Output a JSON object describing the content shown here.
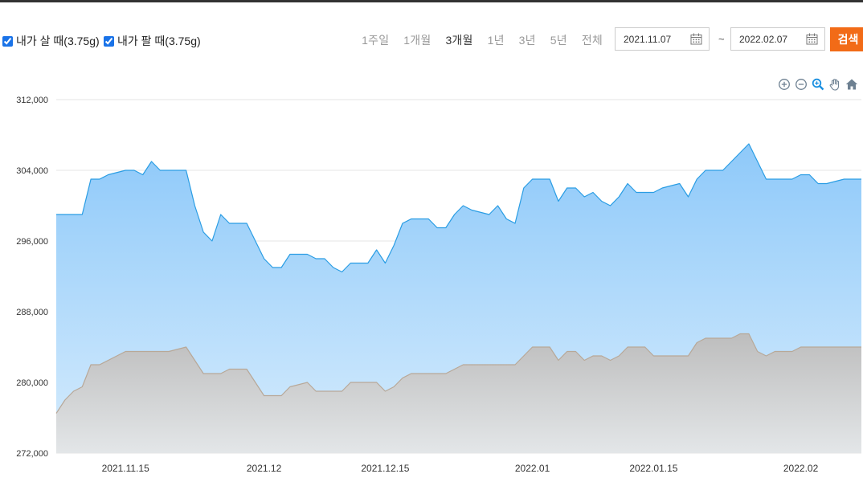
{
  "filters": {
    "buy_label": "내가 살 때(3.75g)",
    "sell_label": "내가 팔 때(3.75g)"
  },
  "periods": [
    {
      "label": "1주일",
      "active": false
    },
    {
      "label": "1개월",
      "active": false
    },
    {
      "label": "3개월",
      "active": true
    },
    {
      "label": "1년",
      "active": false
    },
    {
      "label": "3년",
      "active": false
    },
    {
      "label": "5년",
      "active": false
    },
    {
      "label": "전체",
      "active": false
    }
  ],
  "date_range": {
    "start": "2021.11.07",
    "separator": "~",
    "end": "2022.02.07"
  },
  "search_label": "검색",
  "icons": {
    "zoom_in": "zoom-in-icon",
    "zoom_out": "zoom-out-icon",
    "selection_zoom": "magnifier-icon",
    "pan": "hand-pan-icon",
    "reset": "home-icon",
    "calendar": "calendar-icon"
  },
  "colors": {
    "buy_line": "#2a9de4",
    "buy_fill_top": "#8ec9f9",
    "buy_fill_bottom": "#d6ecfd",
    "sell_line": "#b8a898",
    "sell_fill_top": "#bdbdbd",
    "sell_fill_bottom": "#e3e6e8",
    "search_button": "#f26b17"
  },
  "chart_data": {
    "type": "area",
    "ylim": [
      272000,
      312000
    ],
    "yticks": [
      "272,000",
      "280,000",
      "288,000",
      "296,000",
      "304,000",
      "312,000"
    ],
    "ytick_values": [
      272000,
      280000,
      288000,
      296000,
      304000,
      312000
    ],
    "xlim": [
      0,
      93
    ],
    "xticks": [
      {
        "label": "2021.11.15",
        "x": 8
      },
      {
        "label": "2021.12",
        "x": 24
      },
      {
        "label": "2021.12.15",
        "x": 38
      },
      {
        "label": "2022.01",
        "x": 55
      },
      {
        "label": "2022.01.15",
        "x": 69
      },
      {
        "label": "2022.02",
        "x": 86
      }
    ],
    "grid": true,
    "legend": "top-left",
    "series": [
      {
        "name": "내가 살 때(3.75g)",
        "points": [
          [
            0,
            299000
          ],
          [
            3,
            299000
          ],
          [
            4,
            303000
          ],
          [
            5,
            303000
          ],
          [
            6,
            303500
          ],
          [
            8,
            304000
          ],
          [
            9,
            304000
          ],
          [
            10,
            303500
          ],
          [
            11,
            305000
          ],
          [
            12,
            304000
          ],
          [
            15,
            304000
          ],
          [
            16,
            300000
          ],
          [
            17,
            297000
          ],
          [
            18,
            296000
          ],
          [
            19,
            299000
          ],
          [
            20,
            298000
          ],
          [
            22,
            298000
          ],
          [
            23,
            296000
          ],
          [
            24,
            294000
          ],
          [
            25,
            293000
          ],
          [
            26,
            293000
          ],
          [
            27,
            294500
          ],
          [
            29,
            294500
          ],
          [
            30,
            294000
          ],
          [
            31,
            294000
          ],
          [
            32,
            293000
          ],
          [
            33,
            292500
          ],
          [
            34,
            293500
          ],
          [
            36,
            293500
          ],
          [
            37,
            295000
          ],
          [
            38,
            293500
          ],
          [
            39,
            295500
          ],
          [
            40,
            298000
          ],
          [
            41,
            298500
          ],
          [
            43,
            298500
          ],
          [
            44,
            297500
          ],
          [
            45,
            297500
          ],
          [
            46,
            299000
          ],
          [
            47,
            300000
          ],
          [
            48,
            299500
          ],
          [
            50,
            299000
          ],
          [
            51,
            300000
          ],
          [
            52,
            298500
          ],
          [
            53,
            298000
          ],
          [
            54,
            302000
          ],
          [
            55,
            303000
          ],
          [
            57,
            303000
          ],
          [
            58,
            300500
          ],
          [
            59,
            302000
          ],
          [
            60,
            302000
          ],
          [
            61,
            301000
          ],
          [
            62,
            301500
          ],
          [
            63,
            300500
          ],
          [
            64,
            300000
          ],
          [
            65,
            301000
          ],
          [
            66,
            302500
          ],
          [
            67,
            301500
          ],
          [
            69,
            301500
          ],
          [
            70,
            302000
          ],
          [
            72,
            302500
          ],
          [
            73,
            301000
          ],
          [
            74,
            303000
          ],
          [
            75,
            304000
          ],
          [
            77,
            304000
          ],
          [
            78,
            305000
          ],
          [
            79,
            306000
          ],
          [
            80,
            307000
          ],
          [
            81,
            305000
          ],
          [
            82,
            303000
          ],
          [
            85,
            303000
          ],
          [
            86,
            303500
          ],
          [
            87,
            303500
          ],
          [
            88,
            302500
          ],
          [
            89,
            302500
          ],
          [
            91,
            303000
          ]
        ]
      },
      {
        "name": "내가 팔 때(3.75g)",
        "points": [
          [
            0,
            276500
          ],
          [
            1,
            278000
          ],
          [
            2,
            279000
          ],
          [
            3,
            279500
          ],
          [
            4,
            282000
          ],
          [
            5,
            282000
          ],
          [
            7,
            283000
          ],
          [
            8,
            283500
          ],
          [
            13,
            283500
          ],
          [
            15,
            284000
          ],
          [
            17,
            281000
          ],
          [
            19,
            281000
          ],
          [
            20,
            281500
          ],
          [
            22,
            281500
          ],
          [
            23,
            280000
          ],
          [
            24,
            278500
          ],
          [
            26,
            278500
          ],
          [
            27,
            279500
          ],
          [
            29,
            280000
          ],
          [
            30,
            279000
          ],
          [
            33,
            279000
          ],
          [
            34,
            280000
          ],
          [
            37,
            280000
          ],
          [
            38,
            279000
          ],
          [
            39,
            279500
          ],
          [
            40,
            280500
          ],
          [
            41,
            281000
          ],
          [
            45,
            281000
          ],
          [
            47,
            282000
          ],
          [
            53,
            282000
          ],
          [
            55,
            284000
          ],
          [
            57,
            284000
          ],
          [
            58,
            282500
          ],
          [
            59,
            283500
          ],
          [
            60,
            283500
          ],
          [
            61,
            282500
          ],
          [
            62,
            283000
          ],
          [
            63,
            283000
          ],
          [
            64,
            282500
          ],
          [
            65,
            283000
          ],
          [
            66,
            284000
          ],
          [
            68,
            284000
          ],
          [
            69,
            283000
          ],
          [
            73,
            283000
          ],
          [
            74,
            284500
          ],
          [
            75,
            285000
          ],
          [
            78,
            285000
          ],
          [
            79,
            285500
          ],
          [
            80,
            285500
          ],
          [
            81,
            283500
          ],
          [
            82,
            283000
          ],
          [
            83,
            283500
          ],
          [
            85,
            283500
          ],
          [
            86,
            284000
          ],
          [
            91,
            284000
          ]
        ]
      }
    ]
  }
}
